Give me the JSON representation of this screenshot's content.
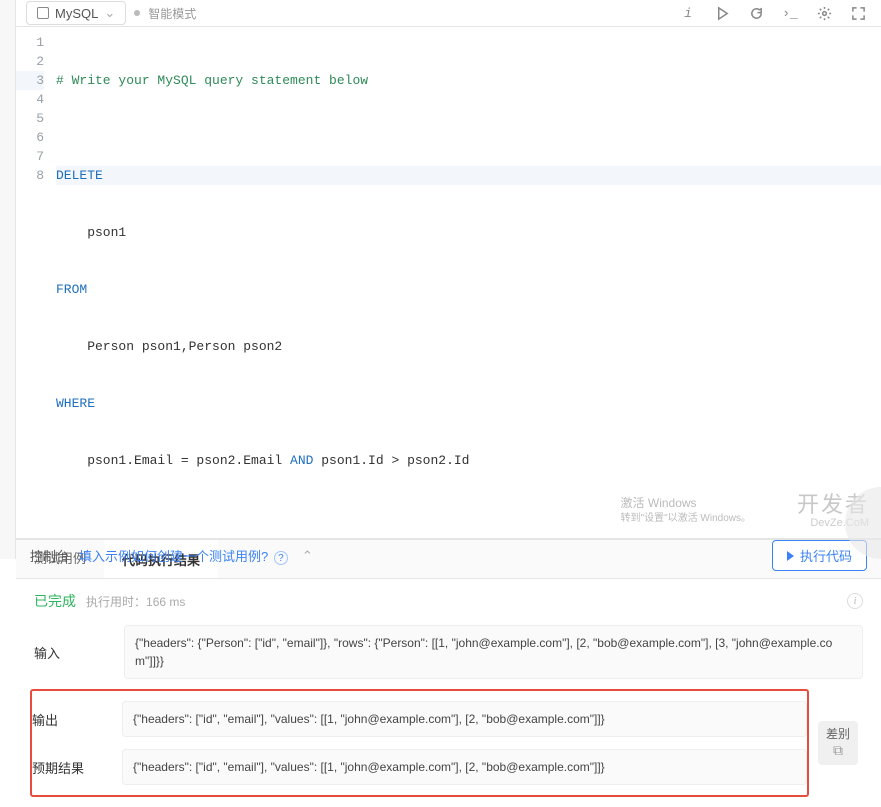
{
  "toolbar": {
    "language": "MySQL",
    "mode_label": "智能模式"
  },
  "code": {
    "lines": [
      {
        "n": 1,
        "type": "comment",
        "text": "# Write your MySQL query statement below"
      },
      {
        "n": 2,
        "type": "",
        "text": ""
      },
      {
        "n": 3,
        "type": "kw",
        "text": "DELETE"
      },
      {
        "n": 4,
        "type": "",
        "text": "    pson1"
      },
      {
        "n": 5,
        "type": "kw",
        "text": "FROM"
      },
      {
        "n": 6,
        "type": "",
        "text": "    Person pson1,Person pson2"
      },
      {
        "n": 7,
        "type": "kw",
        "text": "WHERE"
      },
      {
        "n": 8,
        "type": "mixed",
        "text": "    pson1.Email = pson2.Email AND pson1.Id > pson2.Id"
      }
    ]
  },
  "panel": {
    "tab_testcases": "测试用例",
    "tab_result": "代码执行结果",
    "status": "已完成",
    "runtime_label": "执行用时：",
    "runtime_value": "166 ms",
    "rows": {
      "input_label": "输入",
      "input_value": "{\"headers\": {\"Person\": [\"id\", \"email\"]}, \"rows\": {\"Person\": [[1, \"john@example.com\"], [2, \"bob@example.com\"], [3, \"john@example.com\"]]}}",
      "output_label": "输出",
      "output_value": "{\"headers\": [\"id\", \"email\"], \"values\": [[1, \"john@example.com\"], [2, \"bob@example.com\"]]}",
      "expected_label": "预期结果",
      "expected_value": "{\"headers\": [\"id\", \"email\"], \"values\": [[1, \"john@example.com\"], [2, \"bob@example.com\"]]}",
      "diff_label": "差别"
    }
  },
  "footer": {
    "console_label": "控制台",
    "hint_text": "填入示例如何创建一个测试用例?",
    "run_label": "执行代码"
  },
  "watermark": {
    "activate_title": "激活 Windows",
    "activate_sub": "转到\"设置\"以激活 Windows。",
    "brand": "开发者",
    "brand_sub": "DevZe.CoM"
  }
}
